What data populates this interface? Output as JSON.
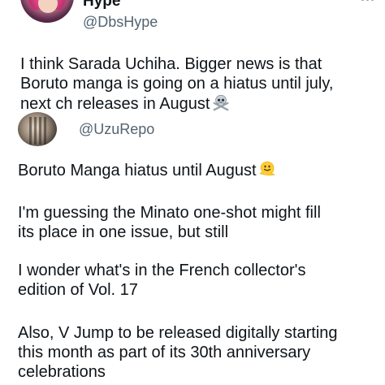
{
  "main_tweet": {
    "display_name_partial": "Hype",
    "handle": "@DbsHype",
    "text_lines": [
      "I think Sarada Uchiha. Bigger news is that",
      "Boruto manga is going on a hiatus until july,",
      "next ch releases in August"
    ],
    "trailing_emoji": "skull-and-crossbones-icon"
  },
  "quoted_tweet": {
    "handle": "@UzuRepo",
    "paragraphs": [
      {
        "lines": [
          "Boruto Manga hiatus until August"
        ],
        "trailing_emoji": "melting-face-icon"
      },
      {
        "lines": [
          "I'm guessing the Minato one-shot might fill",
          "its place in one issue, but still"
        ]
      },
      {
        "lines": [
          "I wonder what's in the French collector's",
          "edition of Vol. 17"
        ]
      },
      {
        "lines": [
          "Also, V Jump to be released digitally starting",
          "this month as part of its 30th anniversary",
          "celebrations"
        ]
      }
    ]
  },
  "colors": {
    "text": "#0f1419",
    "secondary_text": "#536471",
    "background": "#ffffff"
  }
}
